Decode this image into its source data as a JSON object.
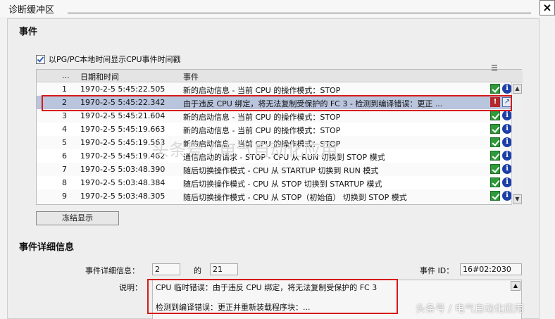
{
  "window": {
    "title": "诊断缓冲区",
    "close_label": "×"
  },
  "events_section": {
    "title": "事件",
    "show_local_time_label": "以PG/PC本地时间显示CPU事件时间戳",
    "show_local_time_checked": true,
    "columns": [
      "...",
      "日期和时间",
      "事件"
    ],
    "rows": [
      {
        "num": "1",
        "datetime": "1970-2-5 5:45:22.505",
        "event": "新的启动信息 - 当前 CPU 的操作模式：STOP",
        "icons": [
          "ok-icon",
          "info-icon"
        ],
        "selected": false
      },
      {
        "num": "2",
        "datetime": "1970-2-5 5:45:22.342",
        "event": "由于违反 CPU 绑定，将无法复制受保护的 FC 3 - 检测到编译错误：更正 ...",
        "icons": [
          "error-icon",
          "goto-icon"
        ],
        "selected": true
      },
      {
        "num": "3",
        "datetime": "1970-2-5 5:45:21.604",
        "event": "新的启动信息 - 当前 CPU 的操作模式：STOP",
        "icons": [
          "ok-icon",
          "info-icon"
        ],
        "selected": false
      },
      {
        "num": "4",
        "datetime": "1970-2-5 5:45:19.663",
        "event": "新的启动信息 - 当前 CPU 的操作模式：STOP",
        "icons": [
          "ok-icon",
          "info-icon"
        ],
        "selected": false
      },
      {
        "num": "5",
        "datetime": "1970-2-5 5:45:19.563",
        "event": "新的启动信息 - 当前 CPU 的操作模式：STOP",
        "icons": [
          "ok-icon",
          "info-icon"
        ],
        "selected": false
      },
      {
        "num": "6",
        "datetime": "1970-2-5 5:45:19.462",
        "event": "通信启动的请求 - STOP - CPU 从 RUN 切换到 STOP 模式",
        "icons": [
          "ok-icon",
          "info-icon"
        ],
        "selected": false
      },
      {
        "num": "7",
        "datetime": "1970-2-5 5:03:48.390",
        "event": "随后切换操作模式 - CPU 从 STARTUP 切换到 RUN 模式",
        "icons": [
          "ok-icon",
          "info-icon"
        ],
        "selected": false
      },
      {
        "num": "8",
        "datetime": "1970-2-5 5:03:48.384",
        "event": "随后切换操作模式 - CPU 从 STOP 切换到 STARTUP 模式",
        "icons": [
          "ok-icon",
          "info-icon"
        ],
        "selected": false
      },
      {
        "num": "9",
        "datetime": "1970-2-5 5:03:48.305",
        "event": "随后切换操作模式 - CPU 从 STOP（初始值） 切换到 STOP 模式",
        "icons": [
          "ok-icon",
          "info-icon"
        ],
        "selected": false
      }
    ],
    "freeze_button_label": "冻结显示"
  },
  "details_section": {
    "title": "事件详细信息",
    "detail_label": "事件详细信息：",
    "detail_value": "2",
    "of_label": "的",
    "total_value": "21",
    "event_id_label": "事件 ID：",
    "event_id_value": "16#02:2030",
    "description_label": "说明：",
    "description_line1": "CPU 临时错误：由于违反 CPU 绑定，将无法复制受保护的 FC 3",
    "description_line2": "检测到编译错误：更正并重新装载程序块：..."
  },
  "watermarks": {
    "center": "头条号 / 电气自动化应用",
    "corner": "头条号 / 电气自动化应用"
  },
  "colors": {
    "highlight": "#d61a1a",
    "selected_row": "#b9c4dd",
    "ok_green": "#2f9a3a",
    "info_blue": "#1c3fa8"
  }
}
